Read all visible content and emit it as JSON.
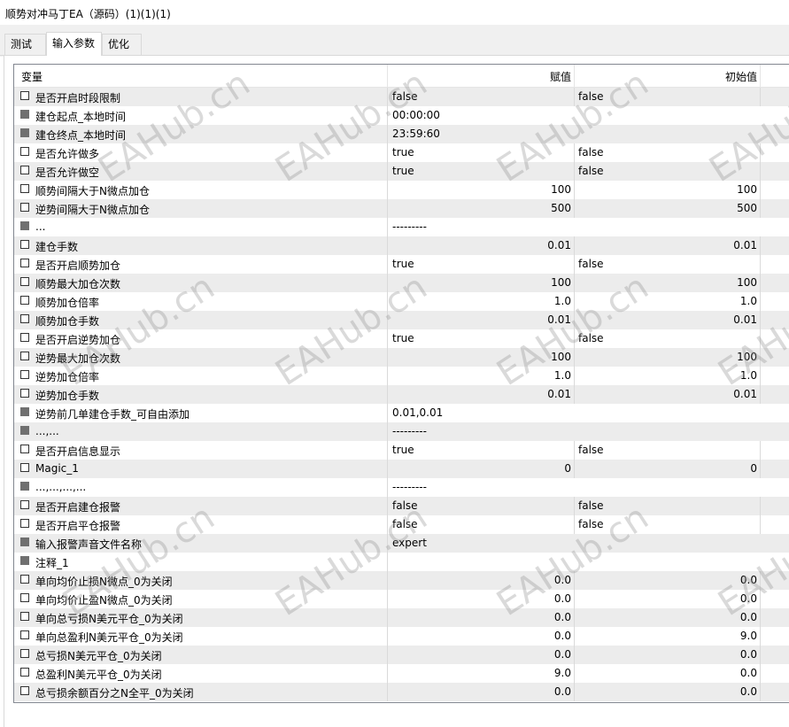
{
  "window": {
    "title": "顺势对冲马丁EA（源码）(1)(1)(1)"
  },
  "tabs": [
    {
      "label": "测试",
      "active": false
    },
    {
      "label": "输入参数",
      "active": true
    },
    {
      "label": "优化",
      "active": false
    }
  ],
  "columns": {
    "variable": "变量",
    "value": "赋值",
    "initial": "初始值"
  },
  "rows": [
    {
      "name": "是否开启时段限制",
      "value": "false",
      "initial": "false",
      "num": false,
      "disabled": false
    },
    {
      "name": "建仓起点_本地时间",
      "value": "00:00:00",
      "initial": "",
      "num": false,
      "disabled": true
    },
    {
      "name": "建仓终点_本地时间",
      "value": "23:59:60",
      "initial": "",
      "num": false,
      "disabled": true
    },
    {
      "name": "是否允许做多",
      "value": "true",
      "initial": "false",
      "num": false,
      "disabled": false
    },
    {
      "name": "是否允许做空",
      "value": "true",
      "initial": "false",
      "num": false,
      "disabled": false
    },
    {
      "name": "顺势间隔大于N微点加仓",
      "value": "100",
      "initial": "100",
      "num": true,
      "disabled": false
    },
    {
      "name": "逆势间隔大于N微点加仓",
      "value": "500",
      "initial": "500",
      "num": true,
      "disabled": false
    },
    {
      "name": "...",
      "value": "---------",
      "initial": "",
      "num": false,
      "disabled": true
    },
    {
      "name": "建仓手数",
      "value": "0.01",
      "initial": "0.01",
      "num": true,
      "disabled": false
    },
    {
      "name": "是否开启顺势加仓",
      "value": "true",
      "initial": "false",
      "num": false,
      "disabled": false
    },
    {
      "name": "顺势最大加仓次数",
      "value": "100",
      "initial": "100",
      "num": true,
      "disabled": false
    },
    {
      "name": "顺势加仓倍率",
      "value": "1.0",
      "initial": "1.0",
      "num": true,
      "disabled": false
    },
    {
      "name": "顺势加仓手数",
      "value": "0.01",
      "initial": "0.01",
      "num": true,
      "disabled": false
    },
    {
      "name": "是否开启逆势加仓",
      "value": "true",
      "initial": "false",
      "num": false,
      "disabled": false
    },
    {
      "name": "逆势最大加仓次数",
      "value": "100",
      "initial": "100",
      "num": true,
      "disabled": false
    },
    {
      "name": "逆势加仓倍率",
      "value": "1.0",
      "initial": "1.0",
      "num": true,
      "disabled": false
    },
    {
      "name": "逆势加仓手数",
      "value": "0.01",
      "initial": "0.01",
      "num": true,
      "disabled": false
    },
    {
      "name": "逆势前几单建仓手数_可自由添加",
      "value": "0.01,0.01",
      "initial": "",
      "num": false,
      "disabled": true
    },
    {
      "name": "...,...",
      "value": "---------",
      "initial": "",
      "num": false,
      "disabled": true
    },
    {
      "name": "是否开启信息显示",
      "value": "true",
      "initial": "false",
      "num": false,
      "disabled": false
    },
    {
      "name": "Magic_1",
      "value": "0",
      "initial": "0",
      "num": true,
      "disabled": false
    },
    {
      "name": "...,...,...,...",
      "value": "---------",
      "initial": "",
      "num": false,
      "disabled": true
    },
    {
      "name": "是否开启建仓报警",
      "value": "false",
      "initial": "false",
      "num": false,
      "disabled": false
    },
    {
      "name": "是否开启平仓报警",
      "value": "false",
      "initial": "false",
      "num": false,
      "disabled": false
    },
    {
      "name": "输入报警声音文件名称",
      "value": "expert",
      "initial": "",
      "num": false,
      "disabled": true
    },
    {
      "name": "注释_1",
      "value": "",
      "initial": "",
      "num": false,
      "disabled": true
    },
    {
      "name": "单向均价止损N微点_0为关闭",
      "value": "0.0",
      "initial": "0.0",
      "num": true,
      "disabled": false
    },
    {
      "name": "单向均价止盈N微点_0为关闭",
      "value": "0.0",
      "initial": "0.0",
      "num": true,
      "disabled": false
    },
    {
      "name": "单向总亏损N美元平仓_0为关闭",
      "value": "0.0",
      "initial": "0.0",
      "num": true,
      "disabled": false
    },
    {
      "name": "单向总盈利N美元平仓_0为关闭",
      "value": "0.0",
      "initial": "9.0",
      "num": true,
      "disabled": false
    },
    {
      "name": "总亏损N美元平仓_0为关闭",
      "value": "0.0",
      "initial": "0.0",
      "num": true,
      "disabled": false
    },
    {
      "name": "总盈利N美元平仓_0为关闭",
      "value": "9.0",
      "initial": "0.0",
      "num": true,
      "disabled": false
    },
    {
      "name": "总亏损余额百分之N全平_0为关闭",
      "value": "0.0",
      "initial": "0.0",
      "num": true,
      "disabled": false
    }
  ],
  "watermark": "EAHub.cn"
}
